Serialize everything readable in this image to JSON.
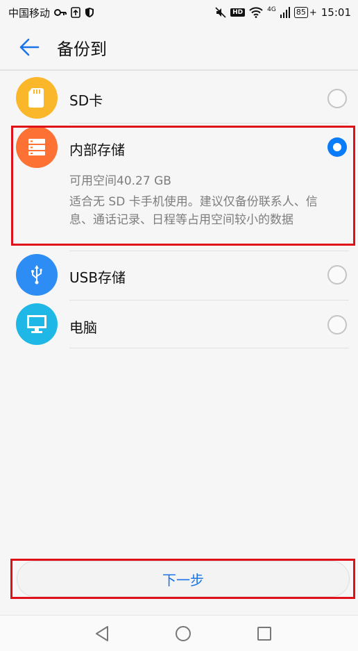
{
  "status_bar": {
    "carrier": "中国移动",
    "network": "4G",
    "battery": "85",
    "time": "15:01",
    "hd": "HD"
  },
  "header": {
    "title": "备份到",
    "back_icon": "arrow-left-icon"
  },
  "options": [
    {
      "label": "SD卡",
      "icon": "sd-card-icon",
      "color": "#fbb72a",
      "selected": false
    },
    {
      "label": "内部存储",
      "icon": "storage-icon",
      "color": "#fd7134",
      "selected": true,
      "capacity": "可用空间40.27 GB",
      "description": "适合无 SD 卡手机使用。建议仅备份联系人、信息、通话记录、日程等占用空间较小的数据"
    },
    {
      "label": "USB存储",
      "icon": "usb-icon",
      "color": "#2e8df5",
      "selected": false
    },
    {
      "label": "电脑",
      "icon": "monitor-icon",
      "color": "#1fb8e6",
      "selected": false
    }
  ],
  "next_button": {
    "label": "下一步"
  },
  "colors": {
    "accent": "#0b7cf7",
    "highlight": "#e0101b"
  }
}
